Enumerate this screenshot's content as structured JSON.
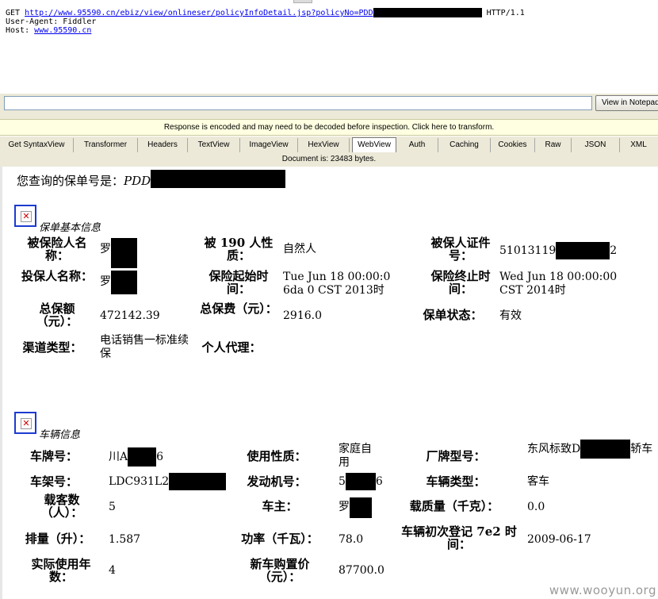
{
  "request": {
    "method": "GET",
    "url": "http://www.95590.cn/ebiz/view/onlineser/policyInfoDetail.jsp?policyNo=PDD",
    "protocol": "HTTP/1.1",
    "user_agent_line": "User-Agent: Fiddler",
    "host_label": "Host:",
    "host": "www.95590.cn"
  },
  "toolbar": {
    "notepad_label": "View in Notepad"
  },
  "notice": "Response is encoded and may need to be decoded before inspection. Click here to transform.",
  "tabs": [
    "Get SyntaxView",
    "Transformer",
    "Headers",
    "TextView",
    "ImageView",
    "HexView",
    "WebView",
    "Auth",
    "Caching",
    "Cookies",
    "Raw",
    "JSON",
    "XML"
  ],
  "active_tab": "WebView",
  "doc_info": "Document is: 23483 bytes.",
  "page": {
    "query_label": "您查询的保单号是：",
    "query_value": "PDD",
    "policy_section": "保单基本信息",
    "vehicle_section": "车辆信息",
    "watermark": "www.wooyun.org"
  },
  "policy": {
    "insured_name_label": "被保险人名称：",
    "insured_name_value": "罗",
    "insured_nature_label": "被 190 人性质：",
    "insured_nature_value": "自然人",
    "insured_id_label": "被保人证件号：",
    "insured_id_value_a": "51013119",
    "insured_id_value_b": "2",
    "holder_name_label": "投保人名称：",
    "holder_name_value": "罗",
    "start_label": "保险起始时间：",
    "start_value": "Tue Jun 18 00:00:0 6da 0 CST 2013时",
    "end_label": "保险终止时间：",
    "end_value": "Wed Jun 18 00:00:00 CST 2014时",
    "sum_insured_label": "总保额（元）：",
    "sum_insured_value": "472142.39",
    "premium_label": "总保费（元）：",
    "premium_value": "2916.0",
    "status_label": "保单状态：",
    "status_value": "有效",
    "channel_label": "渠道类型：",
    "channel_value": "电话销售一标准续保",
    "agent_label": "个人代理："
  },
  "vehicle": {
    "plate_label": "车牌号：",
    "plate_value_a": "川A",
    "plate_value_b": "6",
    "usage_label": "使用性质：",
    "usage_value": "家庭自用",
    "model_label": "厂牌型号：",
    "model_value_a": "东风标致D",
    "model_value_b": "轿车",
    "vin_label": "车架号：",
    "vin_value": "LDC931L2",
    "engine_label": "发动机号：",
    "engine_value_a": "5",
    "engine_value_b": "6",
    "type_label": "车辆类型：",
    "type_value": "客车",
    "seats_label": "载客数（人）：",
    "seats_value": "5",
    "owner_label": "车主：",
    "owner_value": "罗",
    "load_label": "载质量（千克）：",
    "load_value": "0.0",
    "displacement_label": "排量（升）：",
    "displacement_value": "1.587",
    "power_label": "功率（千瓦）：",
    "power_value": "78.0",
    "reg_date_label": "车辆初次登记 7e2 时间：",
    "reg_date_value": "2009-06-17",
    "years_label": "实际使用年数：",
    "years_value": "4",
    "price_label": "新车购置价（元）：",
    "price_value": "87700.0"
  }
}
